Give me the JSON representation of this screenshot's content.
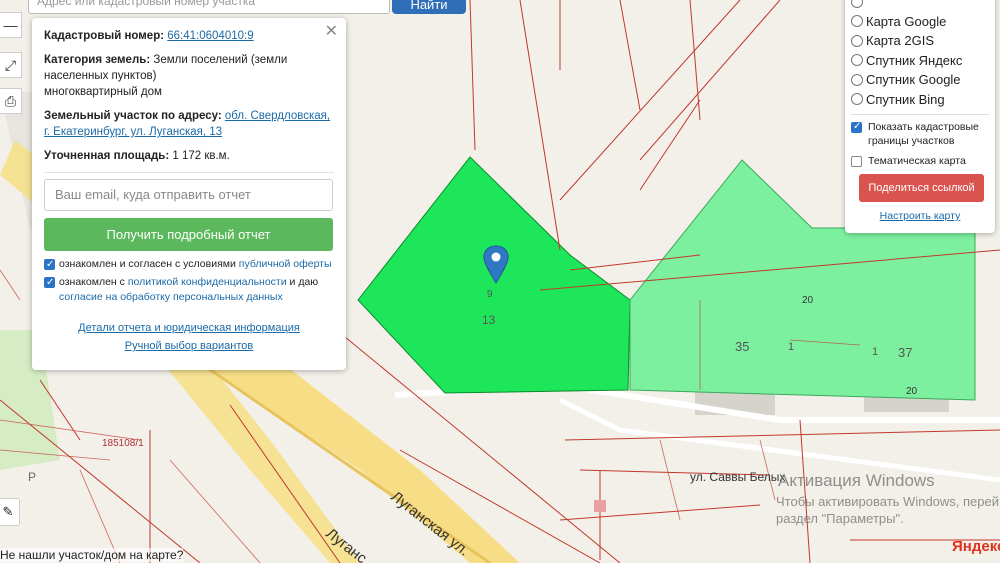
{
  "search": {
    "placeholder": "Адрес или кадастровый номер участка",
    "button_label": "Найти"
  },
  "tools": {
    "zoom_out_icon": "minus-icon",
    "fullscreen_icon": "expand-icon",
    "print_icon": "printer-icon",
    "edit_icon": "pencil-icon"
  },
  "info": {
    "cadastral_label": "Кадастровый номер:",
    "cadastral_value": "66:41:0604010:9",
    "category_label": "Категория земель:",
    "category_value": "Земли поселений (земли населенных пунктов)",
    "category_use": "многоквартирный дом",
    "address_label": "Земельный участок по адресу:",
    "address_value": "обл. Свердловская, г. Екатеринбург, ул. Луганская, 13",
    "area_label": "Уточненная площадь:",
    "area_value": "1 172 кв.м.",
    "email_placeholder": "Ваш email, куда отправить отчет",
    "report_button": "Получить подробный отчет",
    "agree1_text": "ознакомлен и согласен с условиями",
    "agree1_link": "публичной оферты",
    "agree2_text": "ознакомлен с",
    "agree2_link": "политикой конфиденциальности",
    "agree2_mid": "и даю",
    "agree2_link2": "согласие на обработку персональных данных",
    "details_link": "Детали отчета и юридическая информация",
    "manual_link": "Ручной выбор вариантов"
  },
  "layers": {
    "options": [
      "Карта Google",
      "Карта 2GIS",
      "Спутник Яндекс",
      "Спутник Google",
      "Спутник Bing"
    ],
    "show_borders": "Показать кадастровые границы участков",
    "thematic": "Тематическая карта",
    "share_button": "Поделиться ссылкой",
    "config_link": "Настроить карту"
  },
  "map": {
    "street_lugansk": "Луганская ул.",
    "street_lugansk_2": "Луганс",
    "street_savvy": "ул. Саввы Белых",
    "parcel_ref": "185108/1",
    "label_p": "P",
    "num_9": "9",
    "num_13": "13",
    "num_20a": "20",
    "num_35": "35",
    "num_1a": "1",
    "num_1b": "1",
    "num_37": "37",
    "num_20b": "20",
    "selected_color": "#1ee65a",
    "neighbor_color": "#7df0a0"
  },
  "watermark": {
    "title": "Активация Windows",
    "line1": "Чтобы активировать Windows, перей",
    "line2": "раздел \"Параметры\"."
  },
  "yandex_logo": "Яндекс",
  "not_found": "Не нашли участок/дом на карте?"
}
